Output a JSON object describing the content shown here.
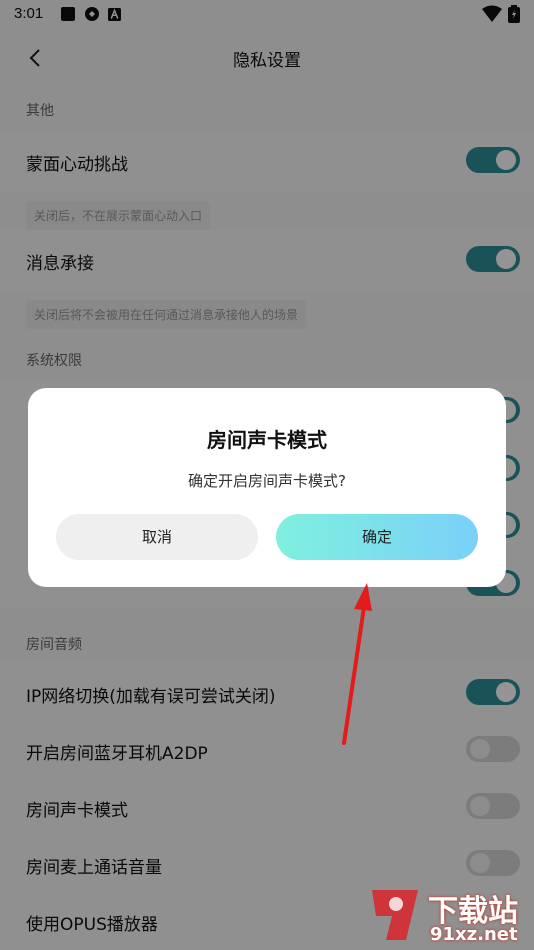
{
  "status_bar": {
    "time": "3:01"
  },
  "nav": {
    "title": "隐私设置"
  },
  "sections": {
    "other": {
      "header": "其他",
      "items": [
        {
          "label": "蒙面心动挑战",
          "hint": "关闭后，不在展示蒙面心动入口",
          "on": true
        },
        {
          "label": "消息承接",
          "hint": "关闭后将不会被用在任何通过消息承接他人的场景",
          "on": true
        }
      ]
    },
    "system": {
      "header": "系统权限"
    },
    "room_audio": {
      "header": "房间音频",
      "items": [
        {
          "label": "IP网络切换(加载有误可尝试关闭)",
          "on": true
        },
        {
          "label": "开启房间蓝牙耳机A2DP",
          "on": false
        },
        {
          "label": "房间声卡模式",
          "on": false
        },
        {
          "label": "房间麦上通话音量",
          "on": false
        },
        {
          "label": "使用OPUS播放器",
          "on": false
        }
      ]
    }
  },
  "dialog": {
    "title": "房间声卡模式",
    "message": "确定开启房间声卡模式?",
    "cancel_label": "取消",
    "confirm_label": "确定"
  },
  "watermark": {
    "brand": "下载站",
    "domain": "91xz.net"
  },
  "colors": {
    "toggle_on": "#2b8f96",
    "confirm_gradient_start": "#7ff0de",
    "confirm_gradient_end": "#7ad0f8",
    "arrow": "#e21b1b"
  }
}
